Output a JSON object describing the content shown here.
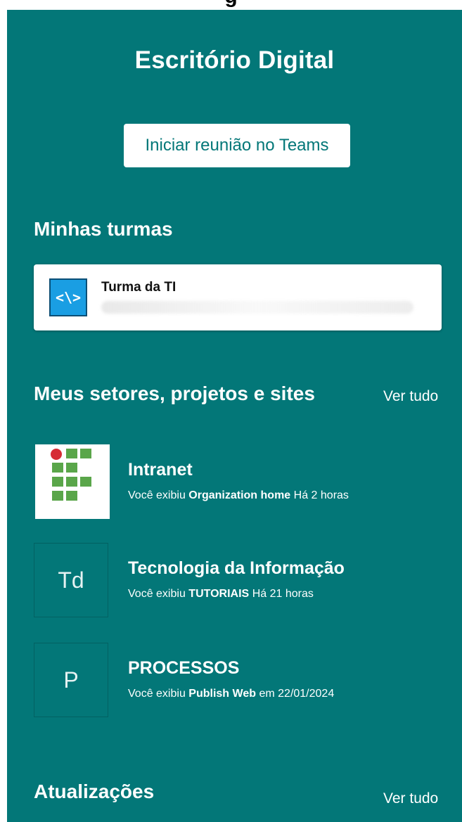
{
  "panel": {
    "title": "Escritório Digital",
    "teams_button": "Iniciar reunião no Teams"
  },
  "my_classes": {
    "title": "Minhas turmas",
    "items": [
      {
        "name": "Turma da TI",
        "icon": "code-brackets-icon"
      }
    ]
  },
  "sites": {
    "title": "Meus setores, projetos e sites",
    "see_all": "Ver tudo",
    "items": [
      {
        "name": "Intranet",
        "prefix": "Você exibiu",
        "page": "Organization home",
        "when": "Há 2 horas",
        "thumb": "ifsp-logo"
      },
      {
        "name": "Tecnologia da Informação",
        "prefix": "Você exibiu",
        "page": "TUTORIAIS",
        "when": "Há 21 horas",
        "thumb_text": "Td"
      },
      {
        "name": "PROCESSOS",
        "prefix": "Você exibiu",
        "page": "Publish Web",
        "when": "em 22/01/2024",
        "thumb_text": "P"
      }
    ]
  },
  "updates": {
    "title": "Atualizações",
    "see_all": "Ver tudo"
  },
  "colors": {
    "panel_bg": "#037778",
    "class_icon_bg": "#1a9ee3",
    "logo_green": "#5aa64a",
    "logo_red": "#d62c35"
  }
}
